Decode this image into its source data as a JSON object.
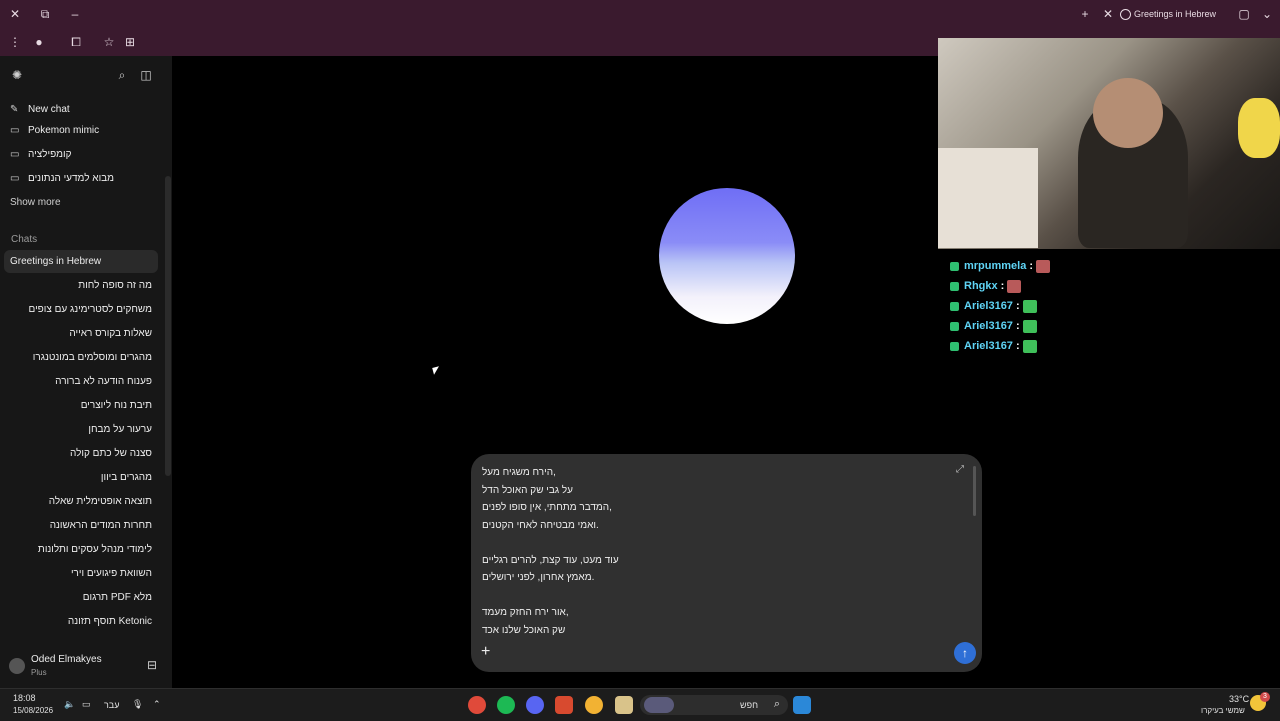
{
  "browser": {
    "tab_title": "Greetings in Hebrew",
    "window_icons": {
      "close": "✕",
      "restore": "⧉",
      "minimize": "–",
      "new_tab": "+",
      "tab_close": "✕",
      "tab_list": "⌄"
    }
  },
  "sidebar": {
    "new_chat": "New chat",
    "projects": [
      "Pokemon mimic",
      "קומפילציה",
      "מבוא למדעי הנתונים"
    ],
    "show_more": "Show more",
    "chats_label": "Chats",
    "active_chat": "Greetings in Hebrew",
    "chats": [
      "מה זה סופה לחות",
      "משחקים לסטרימינג עם צופים",
      "שאלות בקורס ראייה",
      "מהגרים ומוסלמים במונטנגרו",
      "פענוח הודעה לא ברורה",
      "תיבת נוח ליוצרים",
      "ערעור על מבחן",
      "סצנה של כתם קולה",
      "מהגרים ביוון",
      "תוצאה אופטימלית שאלה",
      "תחרות המודים הראשונה",
      "לימודי מנהל עסקים ותלונות",
      "השוואת פיגועים וירי",
      "תרגום PDF מלא",
      "תוסף תזונה Ketonic"
    ],
    "user_name": "Oded Elmakyes",
    "user_plan": "Plus"
  },
  "composer": {
    "text": "הירח משגיח מעל,\nעל גבי שק האוכל הדל\nהמדבר מתחתי, אין סופו לפנים,\nואמי מבטיחה לאחי הקטנים.\n\nעוד מעט, עוד קצת, להרים רגליים\nמאמץ אחרון, לפני ירושלים.\n\nאור ירח החזק מעמד,\nשק האוכל שלנו אכד",
    "plus_label": "+",
    "send_label": "↑"
  },
  "stream_chat": [
    {
      "user": "mrpummela",
      "emote": "#b85a5a"
    },
    {
      "user": "Rhgkx",
      "emote": "#b85a5a"
    },
    {
      "user": "Ariel3167",
      "emote": "#3fbf5a"
    },
    {
      "user": "Ariel3167",
      "emote": "#3fbf5a"
    },
    {
      "user": "Ariel3167",
      "emote": "#3fbf5a"
    }
  ],
  "taskbar": {
    "time": "18:08",
    "date": "15/08/2026",
    "lang": "עבר",
    "search": "חפש",
    "temp": "33°C",
    "weather": "שמשי בעיקרו",
    "notif": "3"
  },
  "colors": {
    "accent": "#2f6fd6",
    "sidebar_bg": "#171717",
    "composer_bg": "#303030"
  }
}
